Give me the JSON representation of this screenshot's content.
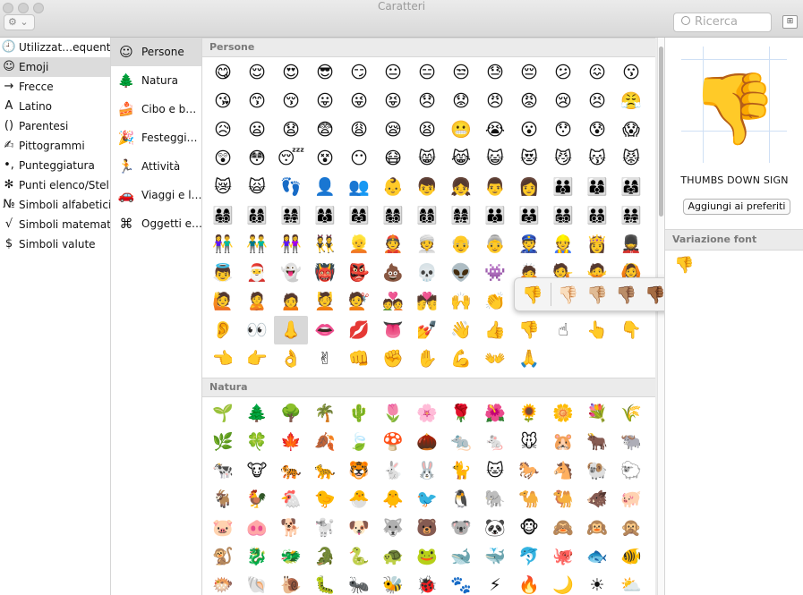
{
  "window": {
    "title": "Caratteri"
  },
  "toolbar": {
    "gear_label": "⚙ ⌄",
    "search_placeholder": "Ricerca",
    "grid_icon": "⊞"
  },
  "left_list": [
    {
      "icon": "🕘",
      "label": "Utilizzat…equente"
    },
    {
      "icon": "☺",
      "label": "Emoji"
    },
    {
      "icon": "→",
      "label": "Frecce"
    },
    {
      "icon": "A",
      "label": "Latino"
    },
    {
      "icon": "()",
      "label": "Parentesi"
    },
    {
      "icon": "✍",
      "label": "Pittogrammi"
    },
    {
      "icon": "•,",
      "label": "Punteggiatura"
    },
    {
      "icon": "✻",
      "label": "Punti elenco/Stelle"
    },
    {
      "icon": "№",
      "label": "Simboli alfabetici"
    },
    {
      "icon": "√",
      "label": "Simboli matematici"
    },
    {
      "icon": "$",
      "label": "Simboli valute"
    }
  ],
  "categories": [
    {
      "icon": "☺",
      "label": "Persone"
    },
    {
      "icon": "🌲",
      "label": "Natura"
    },
    {
      "icon": "🍰",
      "label": "Cibo e b…"
    },
    {
      "icon": "🎉",
      "label": "Festeggi…"
    },
    {
      "icon": "🏃",
      "label": "Attività"
    },
    {
      "icon": "🚗",
      "label": "Viaggi e l…"
    },
    {
      "icon": "⌘",
      "label": "Oggetti e…"
    }
  ],
  "sections": {
    "persone": {
      "title": "Persone",
      "ghost_row": [
        "😊",
        "😂",
        "😃",
        "😄",
        "😅",
        "😆",
        "😇",
        "😈",
        "👿",
        "😉",
        "😊",
        "☺"
      ],
      "emoji": [
        "😋",
        "😌",
        "😍",
        "😎",
        "😏",
        "😐",
        "😑",
        "😒",
        "😓",
        "😔",
        "😕",
        "😖",
        "😗",
        "😘",
        "😙",
        "😚",
        "😛",
        "😜",
        "😝",
        "😞",
        "😟",
        "😠",
        "😡",
        "😢",
        "😣",
        "😤",
        "😥",
        "😦",
        "😧",
        "😨",
        "😩",
        "😪",
        "😫",
        "😬",
        "😭",
        "😮",
        "😯",
        "😰",
        "😱",
        "😲",
        "😳",
        "😴",
        "😵",
        "😶",
        "😷",
        "😸",
        "😹",
        "😺",
        "😻",
        "😼",
        "😽",
        "😾",
        "😿",
        "🙀",
        "👣",
        "👤",
        "👥",
        "👶",
        "👦",
        "👧",
        "👨",
        "👩",
        "👪",
        "👨‍👩‍👦",
        "👨‍👩‍👧",
        "👨‍👩‍👧‍👦",
        "👨‍👩‍👦‍👦",
        "👨‍👩‍👧‍👧",
        "👩‍👩‍👦",
        "👩‍👩‍👧",
        "👩‍👩‍👧‍👦",
        "👩‍👩‍👦‍👦",
        "👩‍👩‍👧‍👧",
        "👨‍👨‍👦",
        "👨‍👨‍👧",
        "👨‍👨‍👧‍👦",
        "👨‍👨‍👦‍👦",
        "👨‍👨‍👧‍👧",
        "👫",
        "👬",
        "👭",
        "👯",
        "👱",
        "👲",
        "👳",
        "👴",
        "👵",
        "👮",
        "👷",
        "👸",
        "💂",
        "👼",
        "🎅",
        "👻",
        "👹",
        "👺",
        "💩",
        "💀",
        "👽",
        "👾",
        "🙇",
        "💁",
        "🙅",
        "🙆",
        "🙋",
        "🙎",
        "🙍",
        "💆",
        "💇",
        "💑",
        "💏",
        "🙌",
        "👏",
        "👂",
        "👀",
        "👃",
        "👄",
        "👂",
        "👀",
        "👃",
        "👄",
        "💋",
        "👅",
        "💅",
        "👋",
        "👍",
        "👎",
        "☝",
        "👆",
        "👇",
        "👈",
        "👉",
        "👌",
        "✌",
        "👊",
        "✊",
        "✋",
        "💪",
        "👐",
        "🙏"
      ]
    },
    "natura": {
      "title": "Natura",
      "emoji": [
        "🌱",
        "🌲",
        "🌳",
        "🌴",
        "🌵",
        "🌷",
        "🌸",
        "🌹",
        "🌺",
        "🌻",
        "🌼",
        "💐",
        "🌾",
        "🌿",
        "🍀",
        "🍁",
        "🍂",
        "🍃",
        "🍄",
        "🌰",
        "🐀",
        "🐁",
        "🐭",
        "🐹",
        "🐂",
        "🐃",
        "🐄",
        "🐮",
        "🐅",
        "🐆",
        "🐯",
        "🐇",
        "🐰",
        "🐈",
        "🐱",
        "🐎",
        "🐴",
        "🐏",
        "🐑",
        "🐐",
        "🐓",
        "🐔",
        "🐤",
        "🐣",
        "🐥",
        "🐦",
        "🐧",
        "🐘",
        "🐪",
        "🐫",
        "🐗",
        "🐖",
        "🐷",
        "🐽",
        "🐕",
        "🐩",
        "🐶",
        "🐺",
        "🐻",
        "🐨",
        "🐼",
        "🐵",
        "🙈",
        "🙉",
        "🙊",
        "🐒",
        "🐉",
        "🐲",
        "🐊",
        "🐍",
        "🐢",
        "🐸",
        "🐋",
        "🐳",
        "🐬",
        "🐙",
        "🐟",
        "🐠",
        "🐡",
        "🐚",
        "🐌",
        "🐛",
        "🐜",
        "🐝",
        "🐞",
        "🐾",
        "⚡",
        "🔥",
        "🌙",
        "☀",
        "⛅"
      ]
    }
  },
  "selected_index": 119,
  "skin_popup": [
    "👎",
    "👎🏻",
    "👎🏼",
    "👎🏽",
    "👎🏾",
    "👎🏿"
  ],
  "inspector": {
    "preview": "👎",
    "char_name": "THUMBS DOWN SIGN",
    "fav_button": "Aggiungi ai preferiti",
    "font_variation_title": "Variazione font",
    "font_variation": "👎"
  }
}
